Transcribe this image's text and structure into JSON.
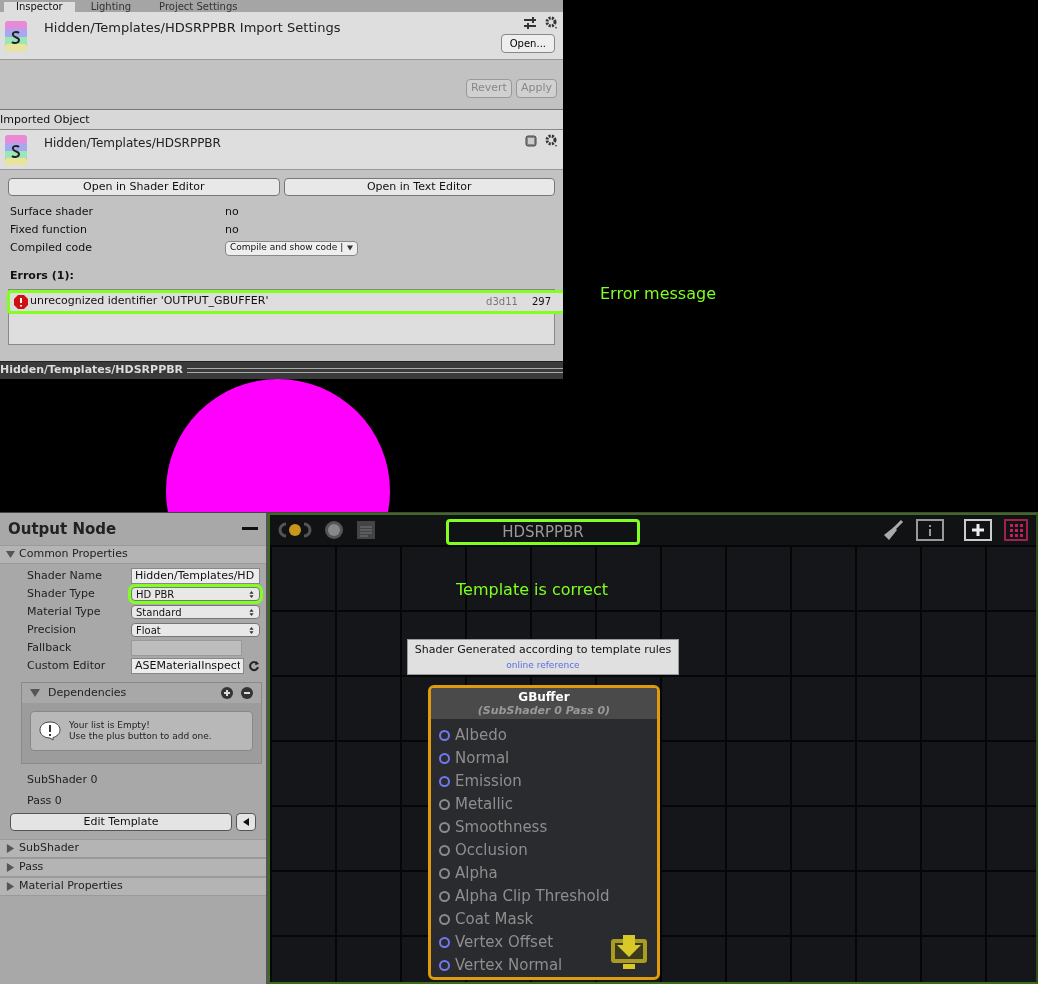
{
  "tabs": [
    {
      "label": "Inspector",
      "selected": true
    },
    {
      "label": "Lighting",
      "selected": false
    },
    {
      "label": "Project Settings",
      "selected": false
    }
  ],
  "import_header": {
    "title": "Hidden/Templates/HDSRPPBR Import Settings",
    "open_button": "Open...",
    "revert_button": "Revert",
    "apply_button": "Apply"
  },
  "imported_object": {
    "section_label": "Imported Object",
    "title": "Hidden/Templates/HDSRPPBR",
    "buttons": [
      "Open in Shader Editor",
      "Open in Text Editor"
    ],
    "properties": [
      {
        "label": "Surface shader",
        "value": "no",
        "kind": "text"
      },
      {
        "label": "Fixed function",
        "value": "no",
        "kind": "text"
      },
      {
        "label": "Compiled code",
        "value": "Compile and show code |",
        "kind": "dropdown"
      }
    ],
    "errors_label": "Errors (1):",
    "errors": [
      {
        "message": "unrecognized identifier 'OUTPUT_GBUFFER'",
        "platform": "d3d11",
        "line": "297"
      }
    ]
  },
  "preview": {
    "title": "Hidden/Templates/HDSRPPBR"
  },
  "annotations": [
    {
      "text": "Error message"
    },
    {
      "text": "Template is correct"
    }
  ],
  "output_node_panel": {
    "title": "Output Node",
    "sections": [
      {
        "label": "Common Properties",
        "expanded": true
      },
      {
        "label": "SubShader",
        "expanded": false
      },
      {
        "label": "Pass",
        "expanded": false
      },
      {
        "label": "Material Properties",
        "expanded": false
      }
    ],
    "fields": [
      {
        "label": "Shader Name",
        "value": "Hidden/Templates/HD",
        "kind": "text"
      },
      {
        "label": "Shader Type",
        "value": "HD PBR",
        "kind": "dropdown"
      },
      {
        "label": "Material Type",
        "value": "Standard",
        "kind": "dropdown"
      },
      {
        "label": "Precision",
        "value": "Float",
        "kind": "dropdown"
      },
      {
        "label": "Fallback",
        "kind": "disabled"
      },
      {
        "label": "Custom Editor",
        "value": "ASEMaterialInspect",
        "kind": "text"
      }
    ],
    "dependencies": {
      "label": "Dependencies",
      "expanded": true,
      "empty_message": "Your list is Empty!\nUse the plus button to add one."
    },
    "subshader_label": "SubShader 0",
    "pass_label": "Pass 0",
    "edit_template_button": "Edit Template"
  },
  "canvas": {
    "title": "HDSRPPBR",
    "tooltip": {
      "text": "Shader Generated according to template rules",
      "link": "online reference"
    },
    "node": {
      "title": "GBuffer",
      "subtitle": "(SubShader 0 Pass 0)",
      "ports": [
        {
          "label": "Albedo",
          "kind": "vector"
        },
        {
          "label": "Normal",
          "kind": "vector"
        },
        {
          "label": "Emission",
          "kind": "vector"
        },
        {
          "label": "Metallic",
          "kind": "float"
        },
        {
          "label": "Smoothness",
          "kind": "float"
        },
        {
          "label": "Occlusion",
          "kind": "float"
        },
        {
          "label": "Alpha",
          "kind": "float"
        },
        {
          "label": "Alpha Clip Threshold",
          "kind": "float"
        },
        {
          "label": "Coat Mask",
          "kind": "float"
        },
        {
          "label": "Vertex Offset",
          "kind": "vector"
        },
        {
          "label": "Vertex Normal",
          "kind": "vector"
        }
      ]
    }
  }
}
